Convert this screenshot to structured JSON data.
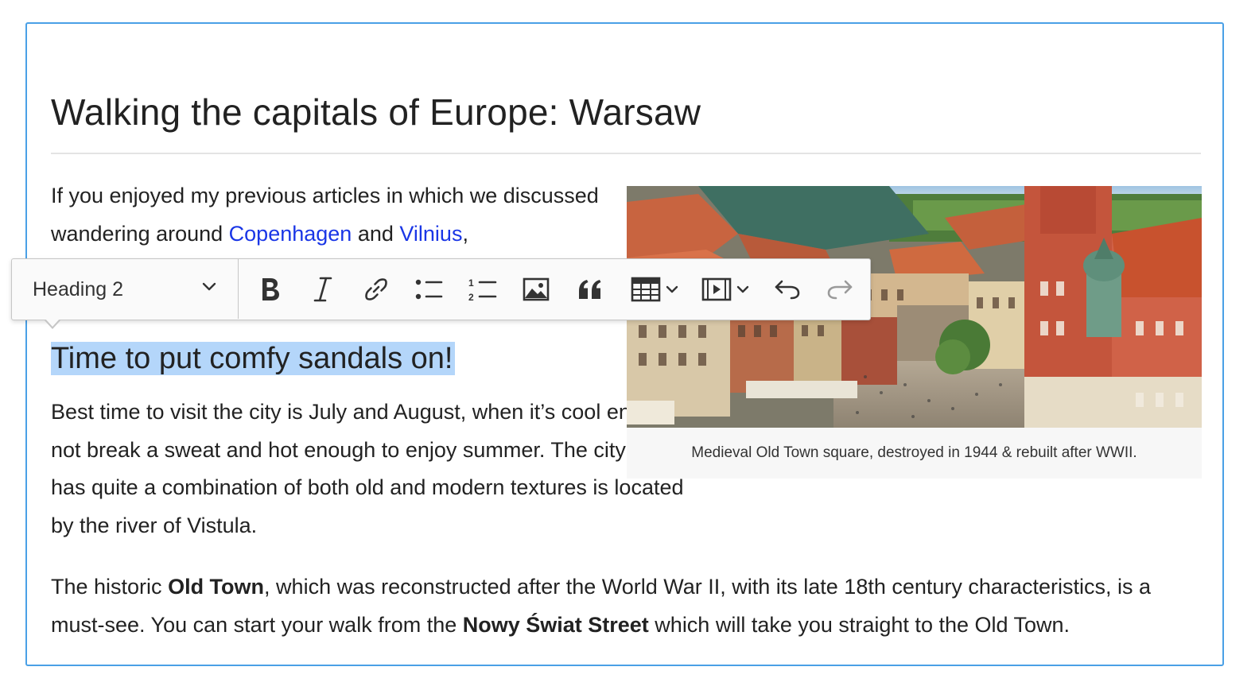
{
  "article": {
    "title": "Walking the capitals of Europe: Warsaw",
    "intro": {
      "before": "If you enjoyed my previous articles in which we discussed wandering around ",
      "link1": "Copenhagen",
      "middle": " and ",
      "link2": "Vilnius",
      "after": ","
    },
    "heading2": "Time to put comfy sandals on!",
    "paragraph2": "Best time to visit the city is July and August, when it’s cool enough to not break a sweat and hot enough to enjoy summer. The city which has quite a combination of both old and modern textures is located by the river of Vistula.",
    "paragraph3": {
      "part1": "The historic ",
      "bold1": "Old Town",
      "part2": ", which was reconstructed after the World War II, with its late 18th century characteristics, is a must-see. You can start your walk from the ",
      "bold2": "Nowy Świat Street",
      "part3": " which will take you straight to the Old Town."
    },
    "image_caption": "Medieval Old Town square, destroyed in 1944 & rebuilt after WWII."
  },
  "toolbar": {
    "heading_select": "Heading 2",
    "buttons": [
      {
        "name": "bold",
        "icon": "bold-icon"
      },
      {
        "name": "italic",
        "icon": "italic-icon"
      },
      {
        "name": "link",
        "icon": "link-icon"
      },
      {
        "name": "bulleted-list",
        "icon": "bulleted-list-icon"
      },
      {
        "name": "numbered-list",
        "icon": "numbered-list-icon"
      },
      {
        "name": "insert-image",
        "icon": "image-icon"
      },
      {
        "name": "block-quote",
        "icon": "quote-icon"
      },
      {
        "name": "insert-table",
        "icon": "table-icon"
      },
      {
        "name": "insert-media",
        "icon": "media-icon"
      },
      {
        "name": "undo",
        "icon": "undo-icon"
      },
      {
        "name": "redo",
        "icon": "redo-icon"
      }
    ]
  },
  "colors": {
    "link": "#1a36e6",
    "selection": "#b4d6fa",
    "editor_border": "#4aa0e6"
  }
}
